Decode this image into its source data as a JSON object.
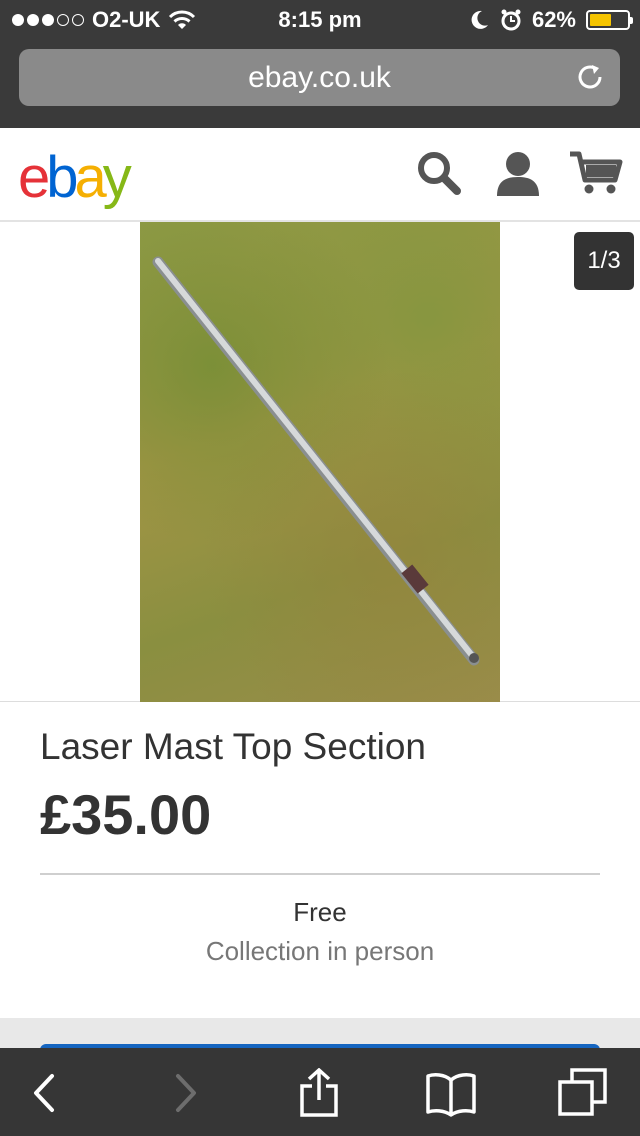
{
  "status": {
    "carrier": "O2-UK",
    "time": "8:15 pm",
    "battery": "62%",
    "battery_level": 0.62,
    "signal_bars": 3,
    "signal_total": 5
  },
  "browser": {
    "url": "ebay.co.uk"
  },
  "header": {
    "logo_letters": [
      "e",
      "b",
      "a",
      "y"
    ],
    "logo_colors": [
      "#e53238",
      "#0064d2",
      "#f5af02",
      "#86b817"
    ]
  },
  "viewer": {
    "counter": "1/3"
  },
  "listing": {
    "title": "Laser Mast Top Section",
    "price": "£35.00",
    "shipping_cost": "Free",
    "shipping_method": "Collection in person"
  },
  "toolbar": {
    "items": [
      "back-icon",
      "forward-icon",
      "share-icon",
      "bookmarks-icon",
      "tabs-icon"
    ]
  }
}
